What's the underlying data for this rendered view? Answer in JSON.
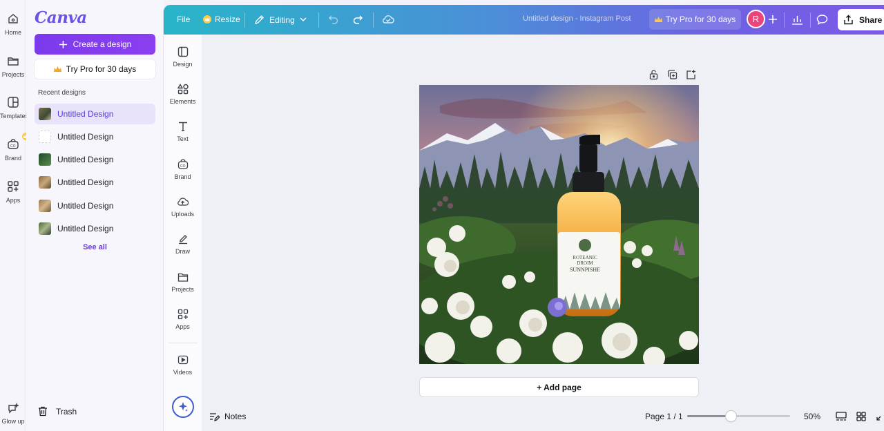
{
  "rail": {
    "items": [
      {
        "label": "Home",
        "icon": "home-icon"
      },
      {
        "label": "Projects",
        "icon": "folder-icon"
      },
      {
        "label": "Templates",
        "icon": "template-icon"
      },
      {
        "label": "Brand",
        "icon": "brand-icon"
      },
      {
        "label": "Apps",
        "icon": "apps-icon"
      }
    ],
    "glow_label": "Glow up"
  },
  "panel": {
    "logo": "Canva",
    "create_label": "Create a design",
    "trypro_label": "Try Pro for 30 days",
    "recent_heading": "Recent designs",
    "recent": [
      {
        "title": "Untitled Design",
        "active": true
      },
      {
        "title": "Untitled Design",
        "active": false
      },
      {
        "title": "Untitled Design",
        "active": false
      },
      {
        "title": "Untitled Design",
        "active": false
      },
      {
        "title": "Untitled Design",
        "active": false
      },
      {
        "title": "Untitled Design",
        "active": false
      }
    ],
    "see_all": "See all",
    "trash": "Trash"
  },
  "topbar": {
    "file": "File",
    "resize": "Resize",
    "editing": "Editing",
    "doc_title": "Untitled design - Instagram Post",
    "trypro": "Try Pro for 30 days",
    "avatar_initial": "R",
    "share": "Share"
  },
  "tools": {
    "items": [
      {
        "label": "Design",
        "icon": "design-layout-icon"
      },
      {
        "label": "Elements",
        "icon": "elements-icon"
      },
      {
        "label": "Text",
        "icon": "text-icon"
      },
      {
        "label": "Brand",
        "icon": "brand-icon"
      },
      {
        "label": "Uploads",
        "icon": "cloud-upload-icon"
      },
      {
        "label": "Draw",
        "icon": "draw-icon"
      },
      {
        "label": "Projects",
        "icon": "folder-icon"
      },
      {
        "label": "Apps",
        "icon": "apps-icon"
      },
      {
        "label": "Videos",
        "icon": "video-icon"
      }
    ]
  },
  "canvas": {
    "label_line1": "ROTEANIC",
    "label_line2": "DROIM",
    "label_line3": "SUNNPISHE",
    "add_page": "+ Add page"
  },
  "footer": {
    "notes": "Notes",
    "page_indicator": "Page 1 / 1",
    "zoom": "50%",
    "zoom_level": 0.42
  },
  "colors": {
    "accent": "#7d2ae8",
    "topbar_start": "#28b5c9",
    "topbar_end": "#7c59e6",
    "avatar": "#e8457a"
  }
}
